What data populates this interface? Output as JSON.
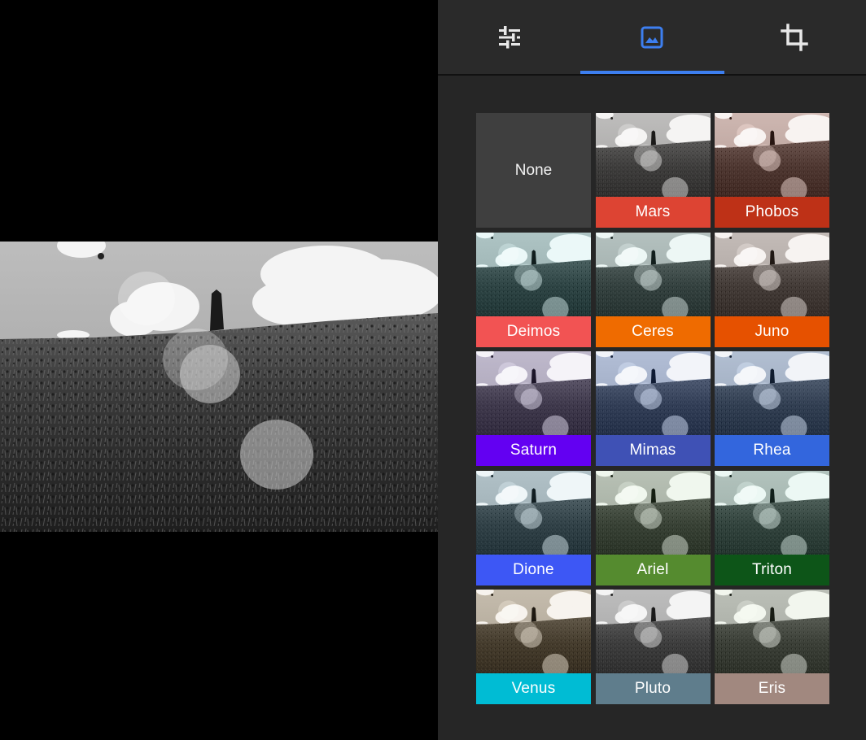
{
  "toolbar": {
    "tabs": [
      {
        "icon": "adjust-sliders-icon",
        "active": false
      },
      {
        "icon": "image-filter-icon",
        "active": true
      },
      {
        "icon": "crop-icon",
        "active": false
      }
    ],
    "accent_color": "#3d7ff0"
  },
  "filters": {
    "none_label": "None",
    "items": [
      {
        "name": "Mars",
        "color": "#dd4433",
        "tint": "#2a1a18",
        "tint_opacity": 0.1
      },
      {
        "name": "Phobos",
        "color": "#be3117",
        "tint": "#6b2a1a",
        "tint_opacity": 0.35
      },
      {
        "name": "Deimos",
        "color": "#f25353",
        "tint": "#1c5a5a",
        "tint_opacity": 0.35
      },
      {
        "name": "Ceres",
        "color": "#ef6b00",
        "tint": "#2f5a52",
        "tint_opacity": 0.3
      },
      {
        "name": "Juno",
        "color": "#e65100",
        "tint": "#5a3a2a",
        "tint_opacity": 0.25
      },
      {
        "name": "Saturn",
        "color": "#6300f2",
        "tint": "#4a3a6a",
        "tint_opacity": 0.4
      },
      {
        "name": "Mimas",
        "color": "#3f51b5",
        "tint": "#1e3a6e",
        "tint_opacity": 0.45
      },
      {
        "name": "Rhea",
        "color": "#3366dd",
        "tint": "#2a4a7a",
        "tint_opacity": 0.4
      },
      {
        "name": "Dione",
        "color": "#3d57f5",
        "tint": "#3a6a7a",
        "tint_opacity": 0.35
      },
      {
        "name": "Ariel",
        "color": "#558b2f",
        "tint": "#3a5a30",
        "tint_opacity": 0.3
      },
      {
        "name": "Triton",
        "color": "#0d5518",
        "tint": "#2a5a4a",
        "tint_opacity": 0.35
      },
      {
        "name": "Venus",
        "color": "#00bcd4",
        "tint": "#8a6a3a",
        "tint_opacity": 0.3
      },
      {
        "name": "Pluto",
        "color": "#5f7d8c",
        "tint": "#202020",
        "tint_opacity": 0.15
      },
      {
        "name": "Eris",
        "color": "#a1887f",
        "tint": "#5a6a4a",
        "tint_opacity": 0.25
      }
    ]
  }
}
